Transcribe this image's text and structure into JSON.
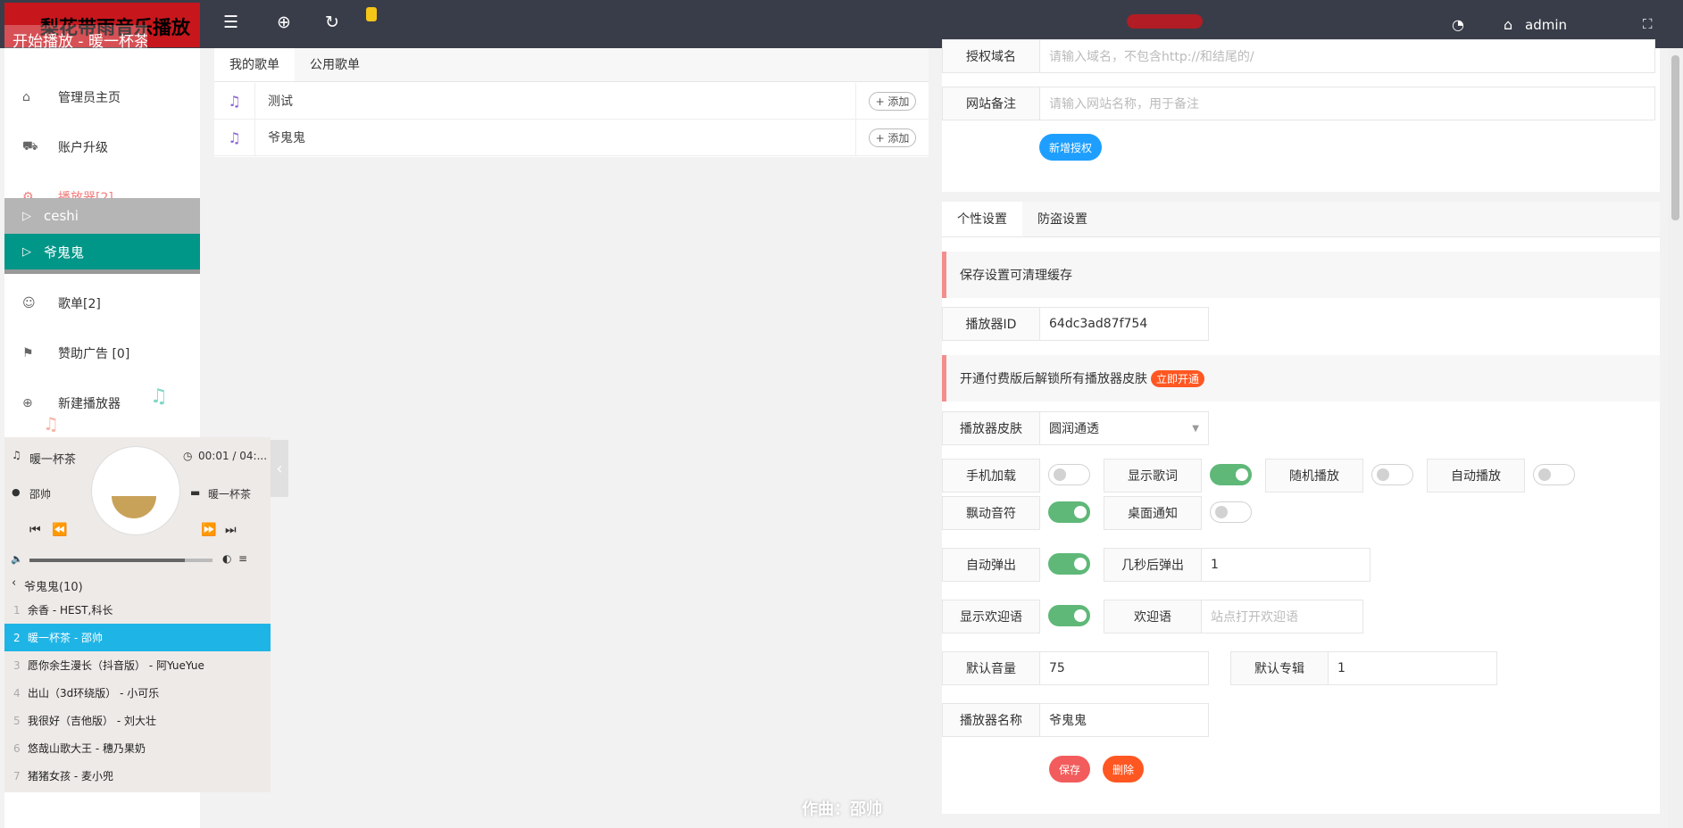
{
  "header": {
    "logo": "梨花带雨音乐播放",
    "ticker": "开始播放 - 暖一杯茶",
    "admin": "admin"
  },
  "sidebar": {
    "items": [
      {
        "label": "管理员主页",
        "icon": "home-icon"
      },
      {
        "label": "账户升级",
        "icon": "cart-icon"
      },
      {
        "label": "播放器[2]",
        "icon": "gear-icon"
      },
      {
        "label": "歌单[2]",
        "icon": "user-icon"
      },
      {
        "label": "赞助广告 [0]",
        "icon": "flag-icon"
      },
      {
        "label": "新建播放器",
        "icon": "plus-circle-icon"
      }
    ],
    "subitems": [
      "ceshi",
      "爷鬼鬼"
    ]
  },
  "player": {
    "song": "暖一杯茶",
    "time": "00:01 / 04:...",
    "artist": "邵帅",
    "album": "暖一杯茶",
    "playlist_title": "爷鬼鬼(10)",
    "playlist": [
      {
        "n": "1",
        "t": "余香 - HEST,科长"
      },
      {
        "n": "2",
        "t": "暖一杯茶 - 邵帅"
      },
      {
        "n": "3",
        "t": "愿你余生漫长（抖音版） - 阿YueYue"
      },
      {
        "n": "4",
        "t": "出山（3d环绕版） - 小可乐"
      },
      {
        "n": "5",
        "t": "我很好（吉他版） - 刘大壮"
      },
      {
        "n": "6",
        "t": "悠哉山歌大王 - 穗乃果奶"
      },
      {
        "n": "7",
        "t": "猪猪女孩 - 麦小兜"
      }
    ],
    "volume": 0.85,
    "progress": 0.01
  },
  "songlist": {
    "tabs": [
      "我的歌单",
      "公用歌单"
    ],
    "rows": [
      "测试",
      "爷鬼鬼"
    ],
    "add_label": "+ 添加"
  },
  "auth": {
    "domain_label": "授权域名",
    "domain_placeholder": "请输入域名，不包含http://和结尾的/",
    "remark_label": "网站备注",
    "remark_placeholder": "请输入网站名称，用于备注",
    "add_button": "新增授权"
  },
  "settings": {
    "tabs": [
      "个性设置",
      "防盗设置"
    ],
    "notice1": "保存设置可清理缓存",
    "player_id_label": "播放器ID",
    "player_id": "64dc3ad87f754",
    "notice2": "开通付费版后解锁所有播放器皮肤",
    "open_now": "立即开通",
    "skin_label": "播放器皮肤",
    "skin_value": "圆润通透",
    "toggles": [
      {
        "label": "手机加载",
        "on": false
      },
      {
        "label": "显示歌词",
        "on": true
      },
      {
        "label": "随机播放",
        "on": false
      },
      {
        "label": "自动播放",
        "on": false
      },
      {
        "label": "飘动音符",
        "on": true
      },
      {
        "label": "桌面通知",
        "on": false
      }
    ],
    "autopop_label": "自动弹出",
    "autopop_on": true,
    "delay_label": "几秒后弹出",
    "delay_value": "1",
    "welcome_show_label": "显示欢迎语",
    "welcome_show_on": true,
    "welcome_label": "欢迎语",
    "welcome_placeholder": "站点打开欢迎语",
    "volume_label": "默认音量",
    "volume_value": "75",
    "album_label": "默认专辑",
    "album_value": "1",
    "name_label": "播放器名称",
    "name_value": "爷鬼鬼",
    "save": "保存",
    "delete": "删除"
  },
  "footer_lyric": "作曲：邵帅",
  "colors": {
    "accent": "#009688",
    "brand": "#c8161d",
    "blue": "#1e9fff",
    "green": "#5fb878",
    "orange": "#ff5722"
  }
}
